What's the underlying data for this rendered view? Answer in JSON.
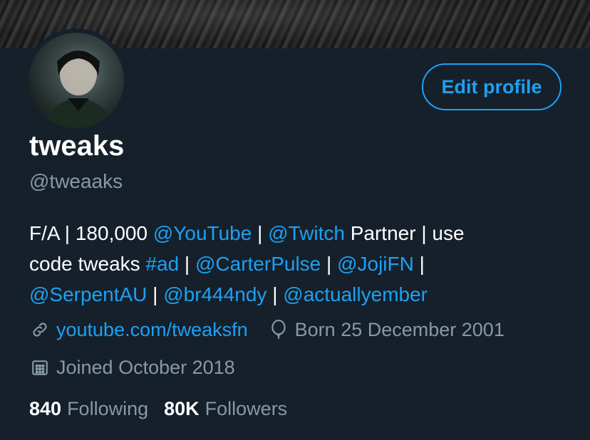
{
  "profile": {
    "name": "tweaks",
    "handle": "@tweaaks",
    "edit_label": "Edit profile"
  },
  "bio": {
    "line1": [
      {
        "text": "F/A | 180,000 ",
        "link": false
      },
      {
        "text": "@YouTube",
        "link": true
      },
      {
        "text": " | ",
        "link": false
      },
      {
        "text": "@Twitch",
        "link": true
      },
      {
        "text": " Partner | use",
        "link": false
      }
    ],
    "line2": [
      {
        "text": "code tweaks ",
        "link": false
      },
      {
        "text": "#ad",
        "link": true
      },
      {
        "text": " | ",
        "link": false
      },
      {
        "text": "@CarterPulse",
        "link": true
      },
      {
        "text": " | ",
        "link": false
      },
      {
        "text": "@JojiFN",
        "link": true
      },
      {
        "text": " |",
        "link": false
      }
    ],
    "line3": [
      {
        "text": "@SerpentAU",
        "link": true
      },
      {
        "text": " | ",
        "link": false
      },
      {
        "text": "@br444ndy",
        "link": true
      },
      {
        "text": " | ",
        "link": false
      },
      {
        "text": "@actuallyember",
        "link": true
      }
    ]
  },
  "meta": {
    "website": "youtube.com/tweaksfn",
    "born": "Born 25 December 2001",
    "joined": "Joined October 2018",
    "icons": [
      "link-icon",
      "balloon-icon",
      "calendar-icon"
    ]
  },
  "stats": {
    "following_count": "840",
    "following_label": "Following",
    "followers_count": "80K",
    "followers_label": "Followers"
  },
  "colors": {
    "background": "#15202b",
    "accent": "#1da1f2",
    "secondary_text": "#8899a6"
  }
}
